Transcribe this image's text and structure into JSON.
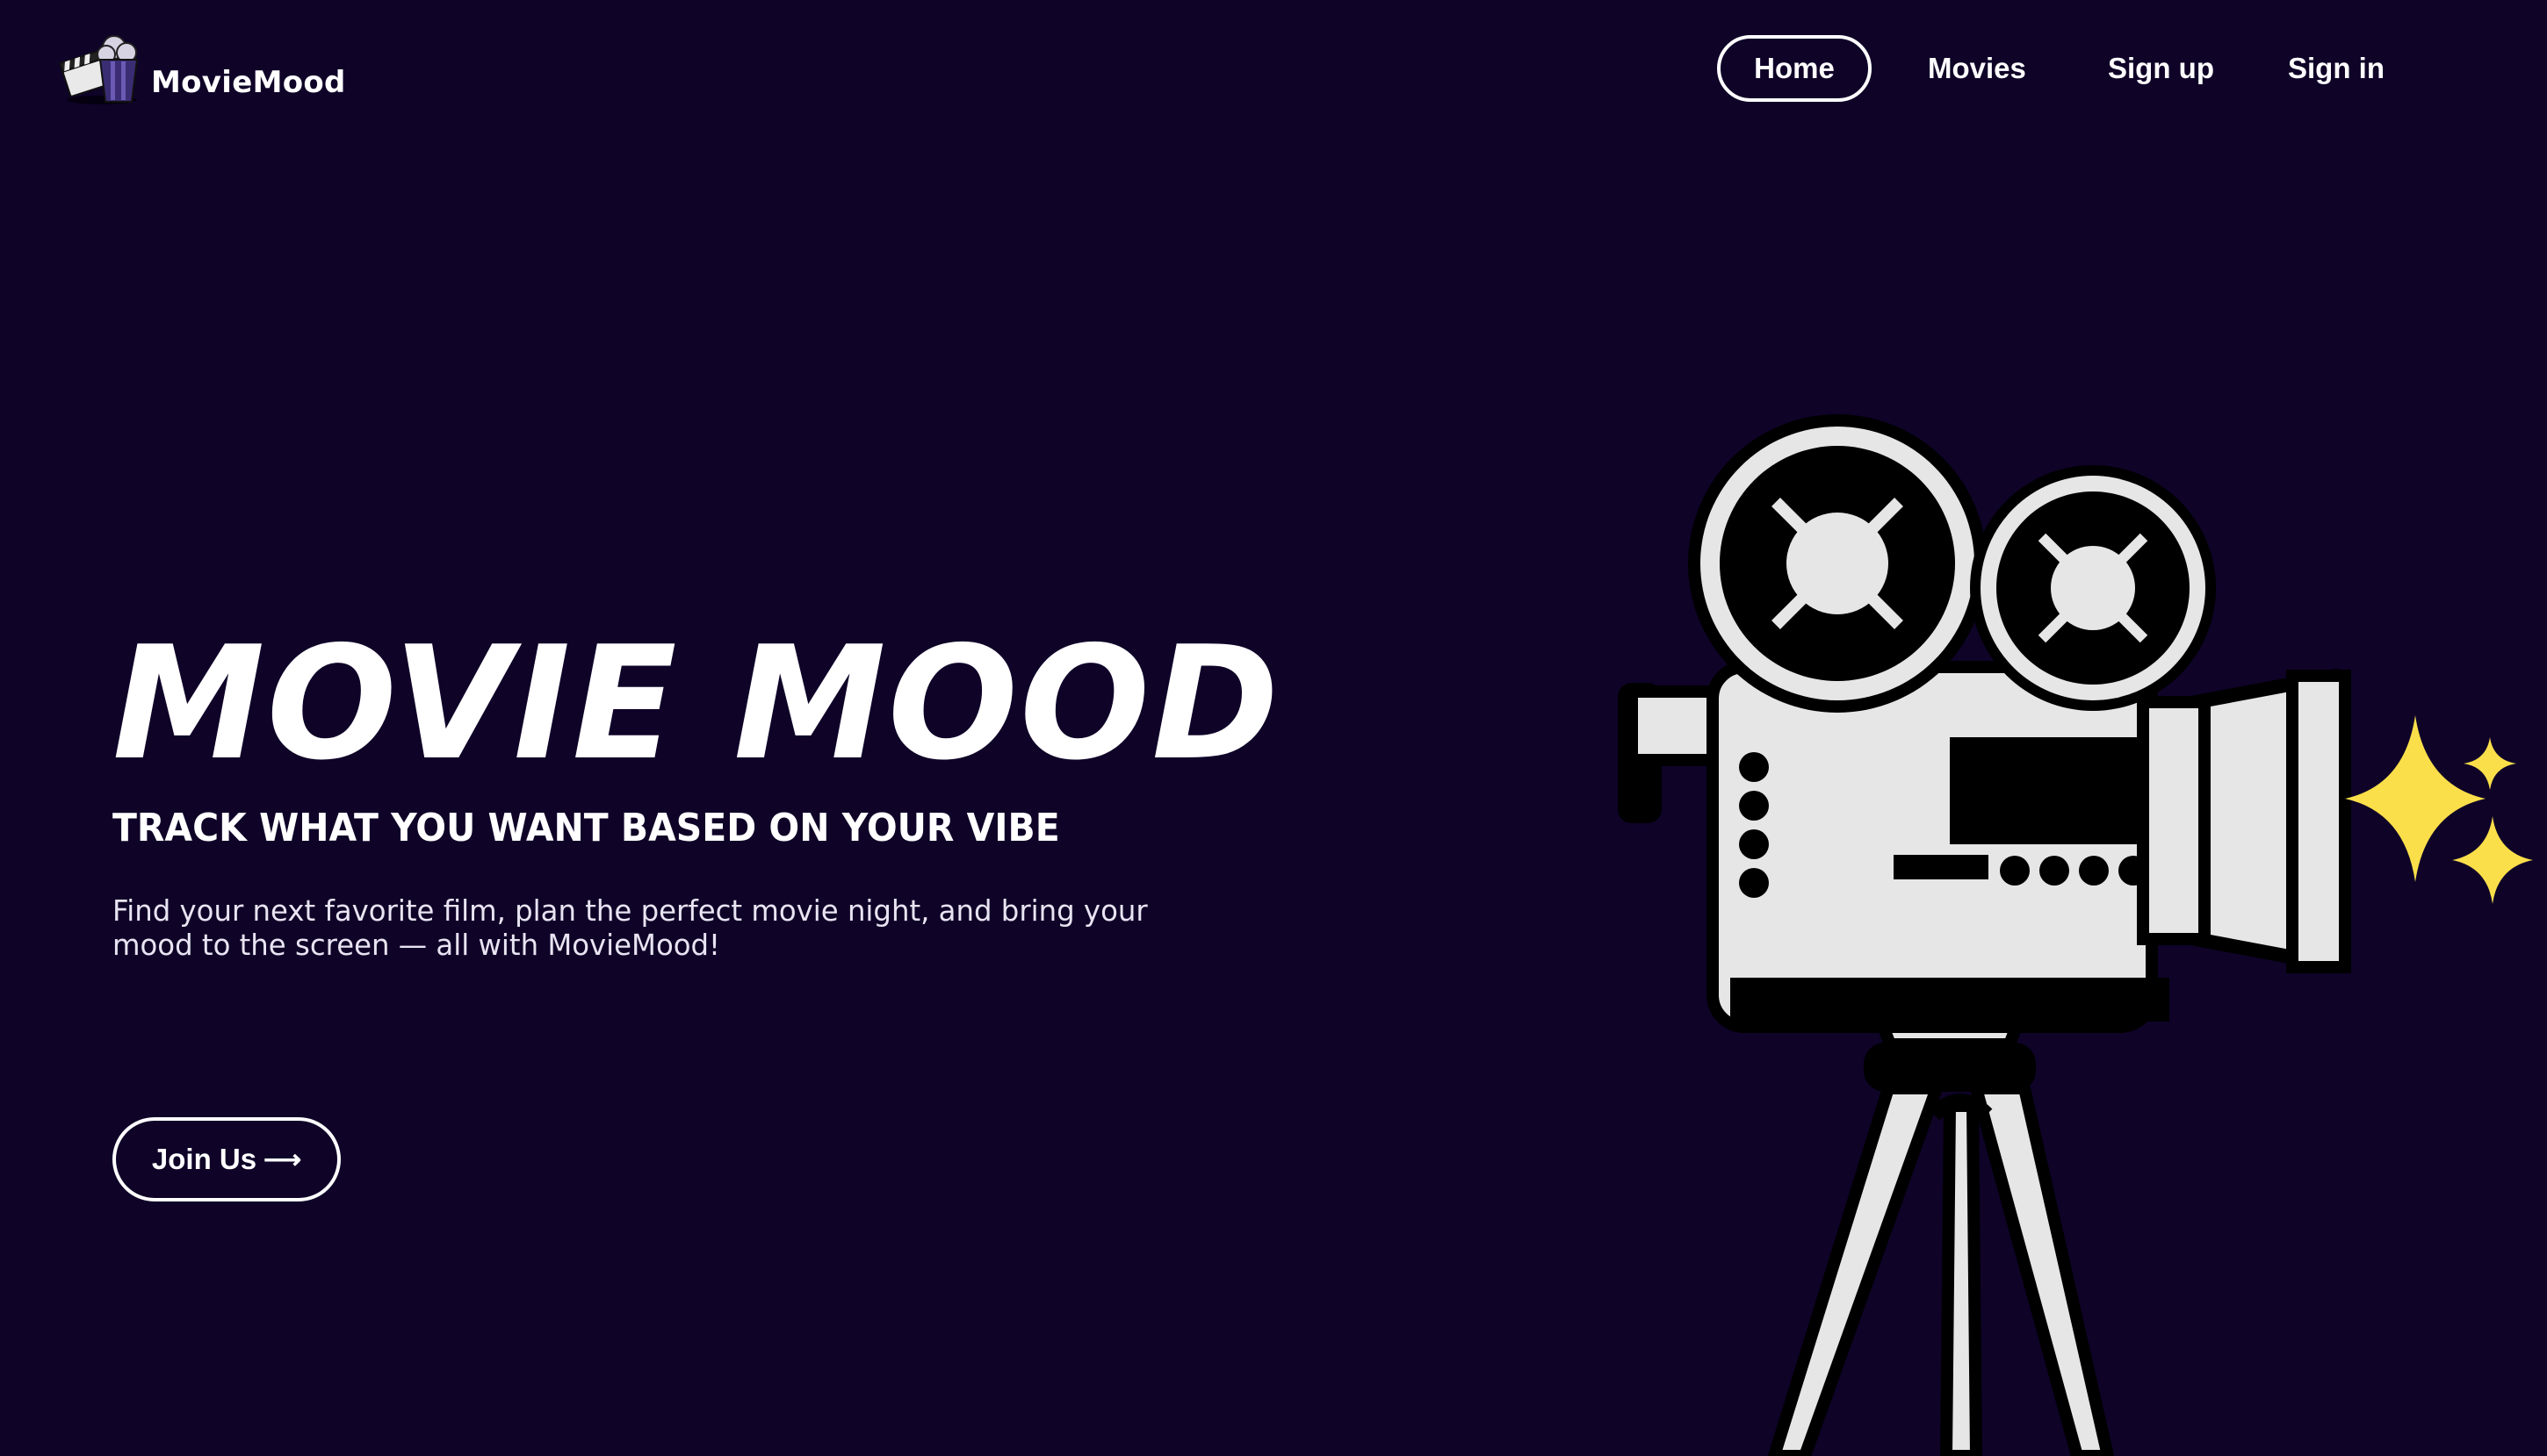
{
  "brand": {
    "name": "MovieMood",
    "logo_icon": "popcorn-clapperboard-icon"
  },
  "nav": {
    "items": [
      {
        "label": "Home",
        "active": true
      },
      {
        "label": "Movies",
        "active": false
      },
      {
        "label": "Sign up",
        "active": false
      },
      {
        "label": "Sign in",
        "active": false
      }
    ]
  },
  "hero": {
    "title": "MOVIE MOOD",
    "subtitle": "TRACK WHAT YOU WANT BASED ON YOUR VIBE",
    "description": "Find your next favorite film, plan the perfect movie night, and bring your mood to the screen — all with MovieMood!",
    "cta_label": "Join Us",
    "cta_icon": "long-arrow-right-icon",
    "illustration": "film-camera-on-tripod-icon",
    "sparkle_icon": "sparkles-icon"
  },
  "colors": {
    "background": "#0f0328",
    "text": "#ffffff",
    "camera_body": "#e6e6e6",
    "outline": "#000000",
    "sparkle": "#fbdf4a"
  }
}
